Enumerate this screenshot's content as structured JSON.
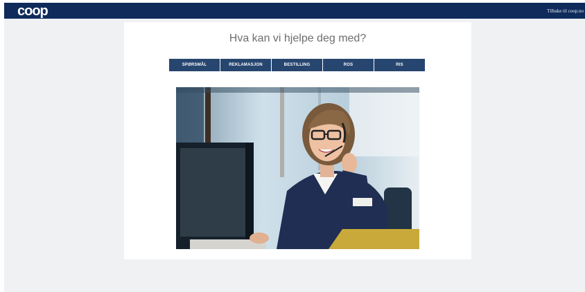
{
  "header": {
    "logo_text": "coop",
    "back_link": "Tilbake til coop.no"
  },
  "main": {
    "headline": "Hva kan vi hjelpe deg med?",
    "tabs": [
      {
        "label": "SPØRSMÅL"
      },
      {
        "label": "REKLAMASJON"
      },
      {
        "label": "BESTILLING"
      },
      {
        "label": "ROS"
      },
      {
        "label": "RIS"
      }
    ]
  },
  "colors": {
    "brand_navy": "#0f2b5b",
    "tab_blue": "#27466f",
    "page_background": "#eff1f2"
  }
}
